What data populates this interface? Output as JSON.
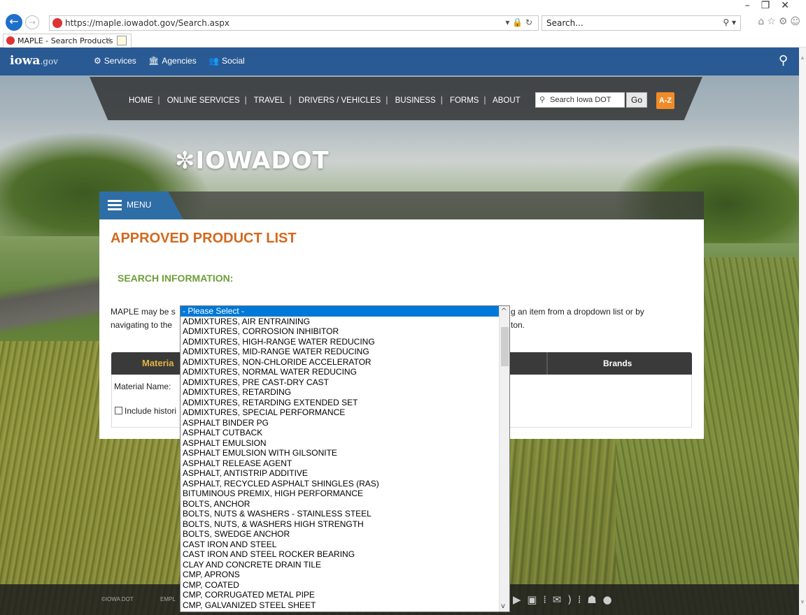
{
  "browser": {
    "url": "https://maple.iowadot.gov/Search.aspx",
    "search_placeholder": "Search...",
    "tab_title": "MAPLE - Search Products"
  },
  "govbar": {
    "logo": "iowa",
    "logo_suffix": ".gov",
    "nav": [
      "Services",
      "Agencies",
      "Social"
    ]
  },
  "dotnav": {
    "links": [
      "HOME",
      "ONLINE SERVICES",
      "TRAVEL",
      "DRIVERS / VEHICLES",
      "BUSINESS",
      "FORMS",
      "ABOUT"
    ],
    "search_placeholder": "Search Iowa DOT",
    "go_label": "Go",
    "az_label": "A-Z"
  },
  "brand": {
    "logo_text": "IOWADOT"
  },
  "menu": {
    "label": "MENU"
  },
  "content": {
    "title": "APPROVED PRODUCT LIST",
    "section": "SEARCH INFORMATION:",
    "intro_line1_left": "MAPLE may be s",
    "intro_line1_right": "g an item from a dropdown list or by",
    "intro_line2_left": "navigating to the",
    "intro_line2_right": "ton.",
    "tab_materials": "Materia",
    "tab_brands": "Brands",
    "material_label": "Material Name:",
    "include_historical": "Include histori"
  },
  "footer": {
    "copyright": "©IOWA DOT",
    "employee": "EMPL"
  },
  "dropdown": {
    "selected": "- Please Select -",
    "options": [
      "ADMIXTURES, AIR ENTRAINING",
      "ADMIXTURES, CORROSION INHIBITOR",
      "ADMIXTURES, HIGH-RANGE WATER REDUCING",
      "ADMIXTURES, MID-RANGE WATER REDUCING",
      "ADMIXTURES, NON-CHLORIDE ACCELERATOR",
      "ADMIXTURES, NORMAL WATER REDUCING",
      "ADMIXTURES, PRE CAST-DRY CAST",
      "ADMIXTURES, RETARDING",
      "ADMIXTURES, RETARDING EXTENDED SET",
      "ADMIXTURES, SPECIAL PERFORMANCE",
      "ASPHALT BINDER PG",
      "ASPHALT CUTBACK",
      "ASPHALT EMULSION",
      "ASPHALT EMULSION WITH GILSONITE",
      "ASPHALT RELEASE AGENT",
      "ASPHALT, ANTISTRIP ADDITIVE",
      "ASPHALT, RECYCLED ASPHALT SHINGLES (RAS)",
      "BITUMINOUS PREMIX, HIGH PERFORMANCE",
      "BOLTS, ANCHOR",
      "BOLTS, NUTS & WASHERS - STAINLESS STEEL",
      "BOLTS, NUTS, & WASHERS HIGH STRENGTH",
      "BOLTS, SWEDGE ANCHOR",
      "CAST IRON AND STEEL",
      "CAST IRON AND STEEL ROCKER BEARING",
      "CLAY AND CONCRETE DRAIN TILE",
      "CMP, APRONS",
      "CMP, COATED",
      "CMP, CORRUGATED METAL PIPE",
      "CMP, GALVANIZED STEEL SHEET"
    ]
  }
}
